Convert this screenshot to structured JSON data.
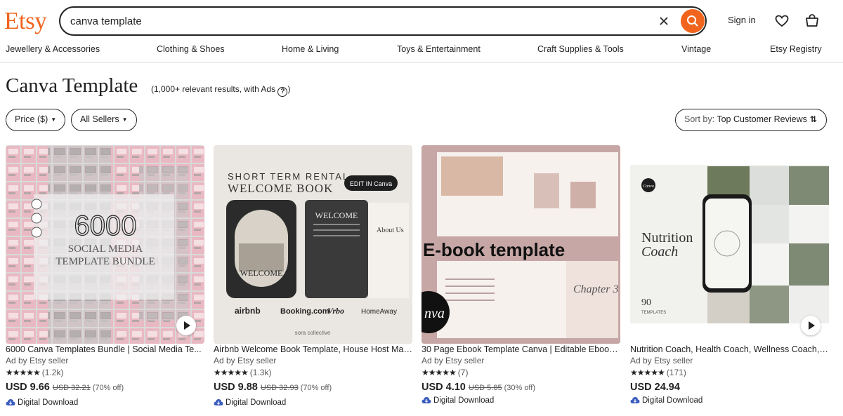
{
  "header": {
    "logo": "Etsy",
    "search_value": "canva template",
    "sign_in": "Sign in"
  },
  "categories": [
    "Jewellery & Accessories",
    "Clothing & Shoes",
    "Home & Living",
    "Toys & Entertainment",
    "Craft Supplies & Tools",
    "Vintage",
    "Etsy Registry"
  ],
  "results": {
    "title": "Canva Template",
    "count_text": "(1,000+ relevant results, with Ads",
    "count_close": ")"
  },
  "filters": {
    "price_label": "Price ($)",
    "sellers_label": "All Sellers",
    "sort_prefix": "Sort by:",
    "sort_value": "Top Customer Reviews"
  },
  "listings": [
    {
      "title": "6000 Canva Templates Bundle | Social Media Te...",
      "ad": "Ad by Etsy seller",
      "rating_count": "(1.2k)",
      "price": "USD 9.66",
      "original_price": "USD 32.21",
      "discount": "(70% off)",
      "delivery": "Digital Download",
      "image_text": {
        "big": "6000",
        "line1": "SOCIAL MEDIA",
        "line2": "TEMPLATE BUNDLE"
      }
    },
    {
      "title": "Airbnb Welcome Book Template, House Host Man...",
      "ad": "Ad by Etsy seller",
      "rating_count": "(1.3k)",
      "price": "USD 9.88",
      "original_price": "USD 32.93",
      "discount": "(70% off)",
      "delivery": "Digital Download",
      "image_text": {
        "line1": "SHORT TERM RENTAL",
        "line2": "WELCOME BOOK",
        "badge": "EDIT IN Canva",
        "welcome": "WELCOME",
        "about": "About Us",
        "logos": [
          "airbnb",
          "Booking.com",
          "Vrbo",
          "HomeAway"
        ],
        "brand": "sora collective"
      }
    },
    {
      "title": "30 Page Ebook Template Canva | Editable Ebook ...",
      "ad": "Ad by Etsy seller",
      "rating_count": "(7)",
      "price": "USD 4.10",
      "original_price": "USD 5.85",
      "discount": "(30% off)",
      "delivery": "Digital Download",
      "image_text": {
        "headline": "E-book template",
        "chapter": "Chapter 3",
        "canva": "nva"
      }
    },
    {
      "title": "Nutrition Coach, Health Coach, Wellness Coach, ...",
      "ad": "Ad by Etsy seller",
      "rating_count": "(171)",
      "price": "USD 24.94",
      "original_price": "",
      "discount": "",
      "delivery": "Digital Download",
      "image_text": {
        "line1": "Nutrition",
        "line2": "Coach",
        "number": "90",
        "sub": "TEMPLATES",
        "canva": "Canva"
      }
    }
  ],
  "colors": {
    "brand": "#f1641e",
    "text": "#222222",
    "muted": "#595959"
  }
}
